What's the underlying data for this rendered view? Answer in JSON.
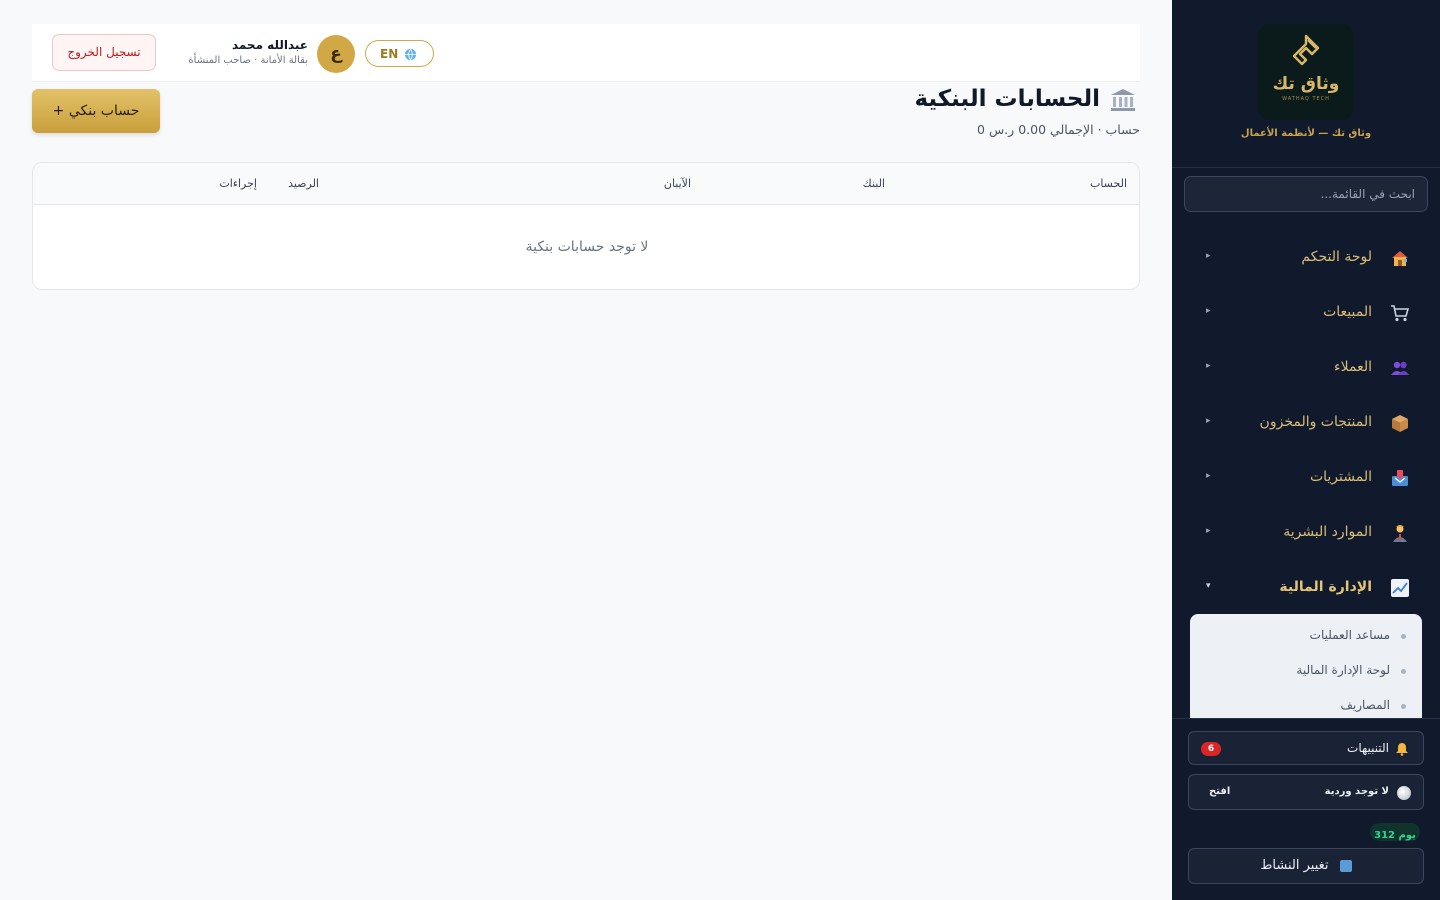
{
  "sidebar": {
    "logo_text": "وثاق تك",
    "logo_sub": "WATHAQ TECH",
    "brand_tag": "وثاق تك — لأنظمة الأعمال",
    "search_placeholder": "ابحث في القائمة...",
    "nav": [
      {
        "label": "لوحة التحكم",
        "icon": "house-icon"
      },
      {
        "label": "المبيعات",
        "icon": "cart-icon"
      },
      {
        "label": "العملاء",
        "icon": "users-icon"
      },
      {
        "label": "المنتجات والمخزون",
        "icon": "box-icon"
      },
      {
        "label": "المشتريات",
        "icon": "inbox-icon"
      },
      {
        "label": "الموارد البشرية",
        "icon": "worker-icon"
      },
      {
        "label": "الإدارة المالية",
        "icon": "chart-icon",
        "active": true
      }
    ],
    "submenu": [
      {
        "label": "مساعد العمليات"
      },
      {
        "label": "لوحة الإدارة المالية"
      },
      {
        "label": "المصاريف"
      }
    ],
    "notifications_label": "التنبيهات",
    "notifications_count": "6",
    "shift_label": "لا توجد وردية",
    "shift_open": "افتح",
    "days_label": "312 يوم",
    "switch_label": "تغيير النشاط"
  },
  "topbar": {
    "logout_label": "تسجيل الخروج",
    "user_name": "عبدالله محمد",
    "user_role": "بقالة الأمانة · صاحب المنشأة",
    "avatar_letter": "ع",
    "lang_label": "EN"
  },
  "page": {
    "title": "الحسابات البنكية",
    "subtitle": "0 حساب · الإجمالي 0.00 ر.س",
    "add_button": "+ حساب بنكي"
  },
  "table": {
    "columns": {
      "account": "الحساب",
      "bank": "البنك",
      "iban": "الآيبان",
      "balance": "الرصيد",
      "actions": "إجراءات"
    },
    "empty_text": "لا توجد حسابات بنكية"
  },
  "colors": {
    "sidebar_bg": "#111a2c",
    "gold_accent": "#d2a846",
    "danger": "#dc2626",
    "success": "#34d399"
  }
}
